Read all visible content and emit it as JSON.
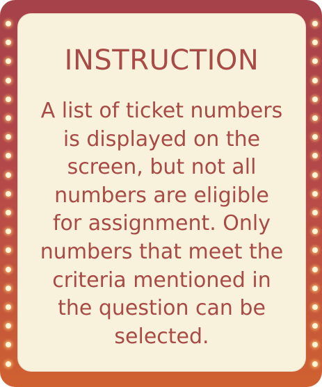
{
  "instruction_card": {
    "title": "INSTRUCTION",
    "text_lines": [
      "A list of ticket numbers",
      "is displayed on the",
      "screen, but not all",
      "numbers are eligible",
      "for assignment. Only",
      "numbers that meet the",
      "criteria mentioned in",
      "the question can be",
      "selected."
    ]
  },
  "colors": {
    "frame_top": "#a6424a",
    "frame_bottom": "#cf6131",
    "panel_background": "#f8f2dd",
    "text": "#a84a45",
    "bulb": "#fff6d8"
  }
}
